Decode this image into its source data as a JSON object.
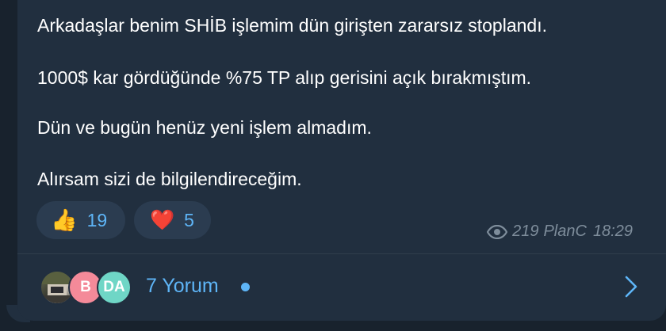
{
  "message": {
    "lines": [
      "Arkadaşlar benim SHİB işlemim dün girişten zararsız stoplandı.",
      "1000$ kar gördüğünde %75 TP alıp gerisini açık bırakmıştım.",
      "Dün ve bugün henüz yeni işlem almadım.",
      "Alırsam sizi de bilgilendireceğim."
    ]
  },
  "reactions": [
    {
      "emoji": "👍",
      "icon": "thumbs-up-icon",
      "count": "19"
    },
    {
      "emoji": "❤️",
      "icon": "heart-icon",
      "count": "5"
    }
  ],
  "meta": {
    "views": "219",
    "author": "PlanC",
    "time": "18:29"
  },
  "comments": {
    "avatars": [
      {
        "initials": "",
        "kind": "photo"
      },
      {
        "initials": "B",
        "color": "#f48a99"
      },
      {
        "initials": "DA",
        "color": "#6fd6c6"
      }
    ],
    "label": "7 Yorum"
  },
  "colors": {
    "bubble": "#212f3f",
    "accent": "#5eb5f7",
    "background": "#18222d"
  }
}
